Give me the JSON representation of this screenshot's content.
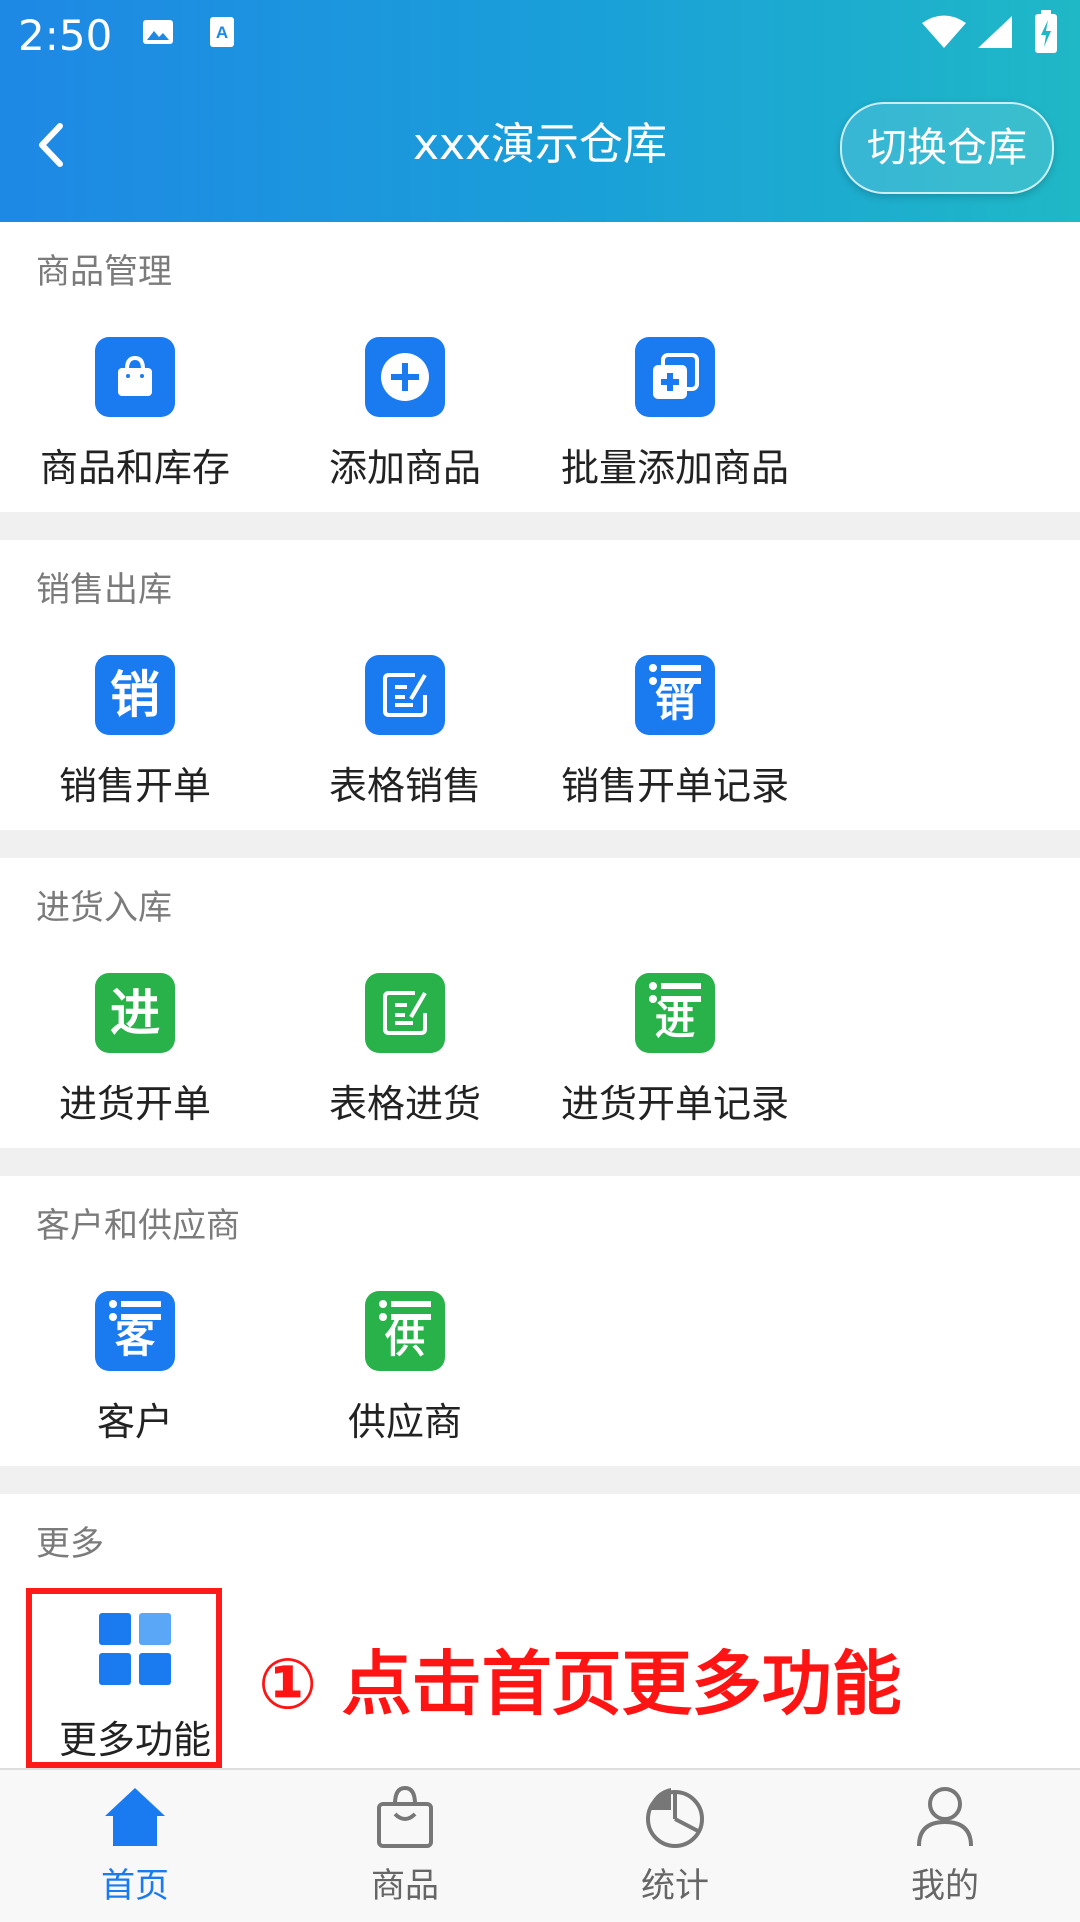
{
  "status_bar": {
    "time": "2:50"
  },
  "header": {
    "title": "xxx演示仓库",
    "switch_label": "切换仓库"
  },
  "sections": [
    {
      "title": "商品管理",
      "items": [
        {
          "label": "商品和库存",
          "icon": "shopping-bag-icon"
        },
        {
          "label": "添加商品",
          "icon": "plus-circle-icon"
        },
        {
          "label": "批量添加商品",
          "icon": "batch-add-icon"
        }
      ]
    },
    {
      "title": "销售出库",
      "items": [
        {
          "label": "销售开单",
          "icon": "sale-char-icon",
          "glyph": "销"
        },
        {
          "label": "表格销售",
          "icon": "edit-form-icon"
        },
        {
          "label": "销售开单记录",
          "icon": "sale-list-icon",
          "glyph": "销"
        }
      ]
    },
    {
      "title": "进货入库",
      "items": [
        {
          "label": "进货开单",
          "icon": "purchase-char-icon",
          "glyph": "进"
        },
        {
          "label": "表格进货",
          "icon": "edit-form-icon"
        },
        {
          "label": "进货开单记录",
          "icon": "purchase-list-icon",
          "glyph": "进"
        }
      ]
    },
    {
      "title": "客户和供应商",
      "items": [
        {
          "label": "客户",
          "icon": "customer-list-icon",
          "glyph": "客"
        },
        {
          "label": "供应商",
          "icon": "supplier-list-icon",
          "glyph": "供"
        }
      ]
    },
    {
      "title": "更多",
      "items": [
        {
          "label": "更多功能",
          "icon": "grid-icon"
        }
      ]
    }
  ],
  "annotation": "① 点击首页更多功能",
  "bottom_nav": [
    {
      "label": "首页",
      "icon": "home-icon",
      "active": true
    },
    {
      "label": "商品",
      "icon": "bag-icon",
      "active": false
    },
    {
      "label": "统计",
      "icon": "pie-chart-icon",
      "active": false
    },
    {
      "label": "我的",
      "icon": "user-icon",
      "active": false
    }
  ],
  "colors": {
    "accent": "#1a7bf0",
    "green": "#29b24a",
    "annotation": "#ff1414"
  }
}
